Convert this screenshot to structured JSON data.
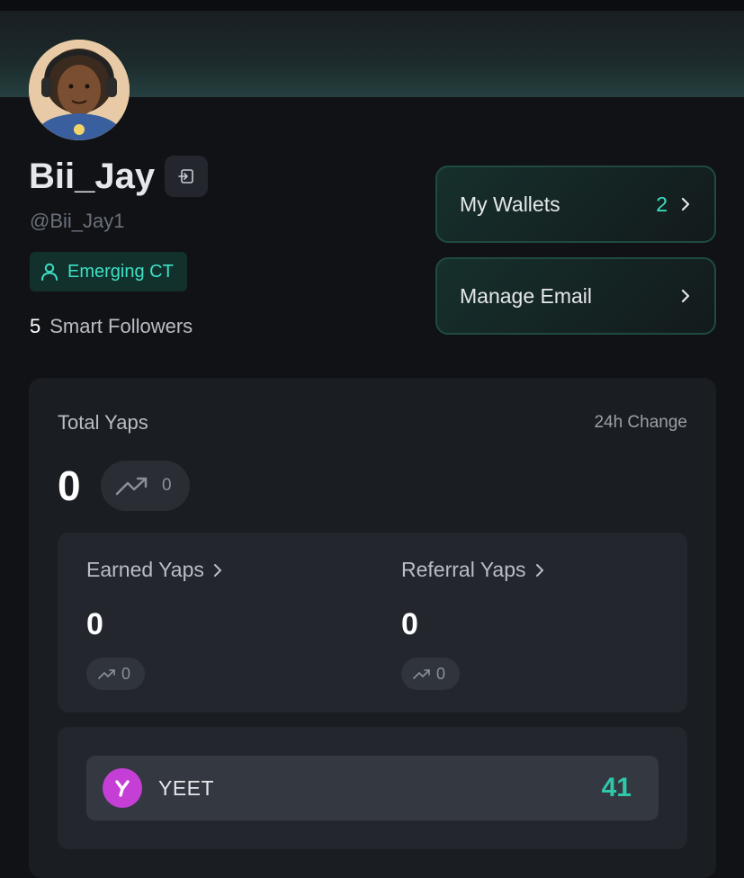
{
  "profile": {
    "username": "Bii_Jay",
    "handle": "@Bii_Jay1",
    "badge": "Emerging CT",
    "smart_followers_count": "5",
    "smart_followers_label": "Smart Followers"
  },
  "actions": {
    "wallets_label": "My Wallets",
    "wallets_count": "2",
    "email_label": "Manage Email"
  },
  "stats": {
    "total_label": "Total Yaps",
    "change_label": "24h Change",
    "total_value": "0",
    "total_change": "0",
    "earned": {
      "label": "Earned Yaps",
      "value": "0",
      "change": "0"
    },
    "referral": {
      "label": "Referral Yaps",
      "value": "0",
      "change": "0"
    }
  },
  "tokens": [
    {
      "name": "YEET",
      "value": "41",
      "icon": "yeet-logo",
      "icon_color": "#c53ed6"
    }
  ],
  "colors": {
    "accent": "#3fe0c5",
    "background": "#101216",
    "card": "#1a1d22",
    "token_value": "#2fc7a9"
  }
}
